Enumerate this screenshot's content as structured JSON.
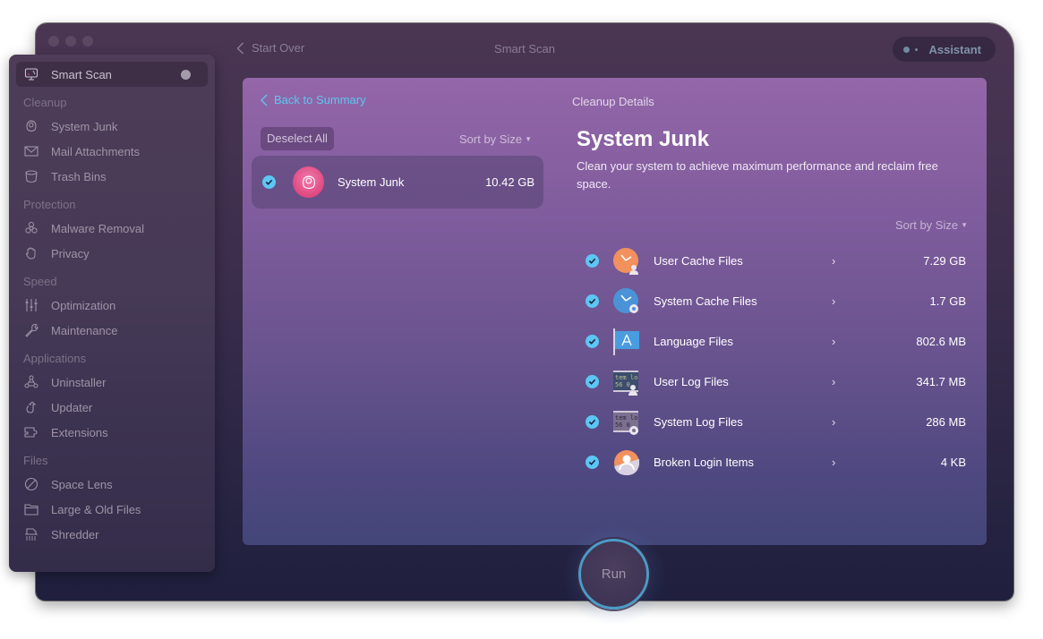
{
  "window": {
    "title": "Smart Scan",
    "start_over": "Start Over",
    "assistant": "Assistant"
  },
  "sidebar": {
    "smart_scan": "Smart Scan",
    "sections": [
      {
        "title": "Cleanup",
        "items": [
          {
            "label": "System Junk",
            "icon": "system-junk-icon"
          },
          {
            "label": "Mail Attachments",
            "icon": "mail-icon"
          },
          {
            "label": "Trash Bins",
            "icon": "trash-icon"
          }
        ]
      },
      {
        "title": "Protection",
        "items": [
          {
            "label": "Malware Removal",
            "icon": "biohazard-icon"
          },
          {
            "label": "Privacy",
            "icon": "hand-icon"
          }
        ]
      },
      {
        "title": "Speed",
        "items": [
          {
            "label": "Optimization",
            "icon": "sliders-icon"
          },
          {
            "label": "Maintenance",
            "icon": "wrench-icon"
          }
        ]
      },
      {
        "title": "Applications",
        "items": [
          {
            "label": "Uninstaller",
            "icon": "uninstaller-icon"
          },
          {
            "label": "Updater",
            "icon": "updater-icon"
          },
          {
            "label": "Extensions",
            "icon": "extensions-icon"
          }
        ]
      },
      {
        "title": "Files",
        "items": [
          {
            "label": "Space Lens",
            "icon": "space-lens-icon"
          },
          {
            "label": "Large & Old Files",
            "icon": "folder-icon"
          },
          {
            "label": "Shredder",
            "icon": "shredder-icon"
          }
        ]
      }
    ]
  },
  "left_panel": {
    "back_link": "Back to Summary",
    "deselect_all": "Deselect All",
    "sort_label": "Sort by Size",
    "category": {
      "name": "System Junk",
      "size": "10.42 GB",
      "checked": true
    }
  },
  "details": {
    "header": "Cleanup Details",
    "title": "System Junk",
    "description": "Clean your system to achieve maximum performance and reclaim free space.",
    "sort_label": "Sort by Size",
    "items": [
      {
        "name": "User Cache Files",
        "size": "7.29 GB",
        "checked": true,
        "icon": "user-cache-icon"
      },
      {
        "name": "System Cache Files",
        "size": "1.7 GB",
        "checked": true,
        "icon": "system-cache-icon"
      },
      {
        "name": "Language Files",
        "size": "802.6 MB",
        "checked": true,
        "icon": "language-files-icon"
      },
      {
        "name": "User Log Files",
        "size": "341.7 MB",
        "checked": true,
        "icon": "user-log-icon"
      },
      {
        "name": "System Log Files",
        "size": "286 MB",
        "checked": true,
        "icon": "system-log-icon"
      },
      {
        "name": "Broken Login Items",
        "size": "4 KB",
        "checked": true,
        "icon": "broken-login-icon"
      }
    ]
  },
  "run_button": "Run",
  "colors": {
    "accent": "#5cc6f4",
    "run_ring": "#4a9bc6"
  }
}
